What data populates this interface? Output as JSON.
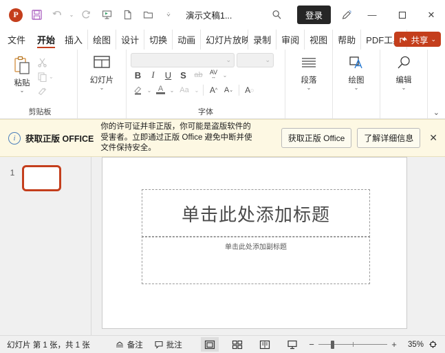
{
  "titlebar": {
    "app_logo": "powerpoint-logo",
    "quick_access": [
      {
        "name": "save-icon",
        "label": "保存"
      },
      {
        "name": "undo-icon",
        "label": "撤消"
      },
      {
        "name": "redo-icon",
        "label": "恢复"
      },
      {
        "name": "start-slideshow-icon",
        "label": "从头开始"
      },
      {
        "name": "new-file-icon",
        "label": "新建"
      },
      {
        "name": "open-folder-icon",
        "label": "打开"
      },
      {
        "name": "customize-qat-icon",
        "label": "自定义快速访问工具栏"
      }
    ],
    "document_title": "演示文稿1...",
    "search_icon": "search-icon",
    "signin_label": "登录",
    "designer_icon": "designer-pen-icon",
    "minimize": "—",
    "maximize": "□",
    "close": "✕"
  },
  "tabs": [
    {
      "label": "文件",
      "active": false
    },
    {
      "label": "开始",
      "active": true
    },
    {
      "label": "插入",
      "active": false
    },
    {
      "label": "绘图",
      "active": false
    },
    {
      "label": "设计",
      "active": false
    },
    {
      "label": "切换",
      "active": false
    },
    {
      "label": "动画",
      "active": false
    },
    {
      "label": "幻灯片放映",
      "active": false
    },
    {
      "label": "录制",
      "active": false
    },
    {
      "label": "审阅",
      "active": false
    },
    {
      "label": "视图",
      "active": false
    },
    {
      "label": "帮助",
      "active": false
    },
    {
      "label": "PDF工具集",
      "active": false
    }
  ],
  "share": {
    "label": "共享",
    "icon": "share-icon",
    "caret": "⌄",
    "color": "#c43e1c"
  },
  "ribbon": {
    "groups": [
      {
        "name": "clipboard",
        "label": "剪贴板",
        "big_button": {
          "label": "粘贴",
          "icon": "paste-icon",
          "caret": "⌄"
        },
        "small_buttons": [
          {
            "label": "剪切",
            "icon": "cut-scissors-icon"
          },
          {
            "label": "复制",
            "icon": "copy-icon",
            "caret": "⌄"
          },
          {
            "label": "格式刷",
            "icon": "format-painter-icon"
          }
        ],
        "has_dialog_launcher": true
      },
      {
        "name": "slides",
        "label": "幻灯片",
        "big_button": {
          "label": "幻灯片",
          "icon": "new-slide-icon",
          "caret": "⌄"
        }
      },
      {
        "name": "font",
        "label": "字体",
        "font_name_value": "",
        "font_size_value": "",
        "buttons": [
          {
            "label": "加粗",
            "icon": "bold-icon",
            "glyph": "B"
          },
          {
            "label": "倾斜",
            "icon": "italic-icon",
            "glyph": "I"
          },
          {
            "label": "下划线",
            "icon": "underline-icon",
            "glyph": "U"
          },
          {
            "label": "文字阴影",
            "icon": "text-shadow-icon",
            "glyph": "S"
          },
          {
            "label": "删除线",
            "icon": "strikethrough-icon",
            "glyph": "ab"
          },
          {
            "label": "字符间距",
            "icon": "character-spacing-icon",
            "glyph": "AV"
          },
          {
            "label": "文本突出显示颜色",
            "icon": "highlight-color-icon"
          },
          {
            "label": "字体颜色",
            "icon": "font-color-icon",
            "glyph": "A"
          },
          {
            "label": "更改大小写",
            "icon": "change-case-icon",
            "glyph": "Aa"
          },
          {
            "label": "增大字号",
            "icon": "increase-font-size-icon",
            "glyph": "A"
          },
          {
            "label": "减小字号",
            "icon": "decrease-font-size-icon",
            "glyph": "A"
          },
          {
            "label": "清除所有格式",
            "icon": "clear-formatting-icon",
            "glyph": "A"
          }
        ],
        "has_dialog_launcher": true
      },
      {
        "name": "paragraph",
        "label": "段落",
        "big_button": {
          "label": "段落",
          "icon": "paragraph-icon",
          "caret": "⌄"
        }
      },
      {
        "name": "drawing",
        "label": "绘图",
        "big_button": {
          "label": "绘图",
          "icon": "drawing-shapes-icon",
          "caret": "⌄"
        }
      },
      {
        "name": "editing",
        "label": "编辑",
        "big_button": {
          "label": "编辑",
          "icon": "editing-search-icon",
          "caret": "⌄"
        }
      }
    ],
    "collapse_icon": "⌄"
  },
  "banner": {
    "icon": "info-circle-icon",
    "title": "获取正版 OFFICE",
    "message": "你的许可证并非正版，你可能是盗版软件的受害者。立即通过正版 Office 避免中断并使文件保持安全。",
    "primary_button": "获取正版 Office",
    "secondary_button": "了解详细信息",
    "close_icon": "✕",
    "background": "#fdf8e3"
  },
  "thumbnails": {
    "slides": [
      {
        "number": "1",
        "selected": true
      }
    ],
    "selection_color": "#c43e1c"
  },
  "slide": {
    "title_placeholder": "单击此处添加标题",
    "subtitle_placeholder": "单击此处添加副标题"
  },
  "statusbar": {
    "slide_info": "幻灯片 第 1 张，共 1 张",
    "notes": {
      "label": "备注",
      "icon": "notes-icon"
    },
    "comments": {
      "label": "批注",
      "icon": "comment-icon"
    },
    "views": [
      {
        "name": "normal-view",
        "icon": "normal-view-icon",
        "active": true
      },
      {
        "name": "slide-sorter-view",
        "icon": "slide-sorter-icon",
        "active": false
      },
      {
        "name": "reading-view",
        "icon": "reading-view-icon",
        "active": false
      },
      {
        "name": "slideshow-view",
        "icon": "slideshow-icon",
        "active": false
      }
    ],
    "zoom_out": "−",
    "zoom_in": "+",
    "zoom_level": "35%",
    "fit_to_window": {
      "name": "fit-slide-icon",
      "label": "使幻灯片适应当前窗口"
    }
  }
}
